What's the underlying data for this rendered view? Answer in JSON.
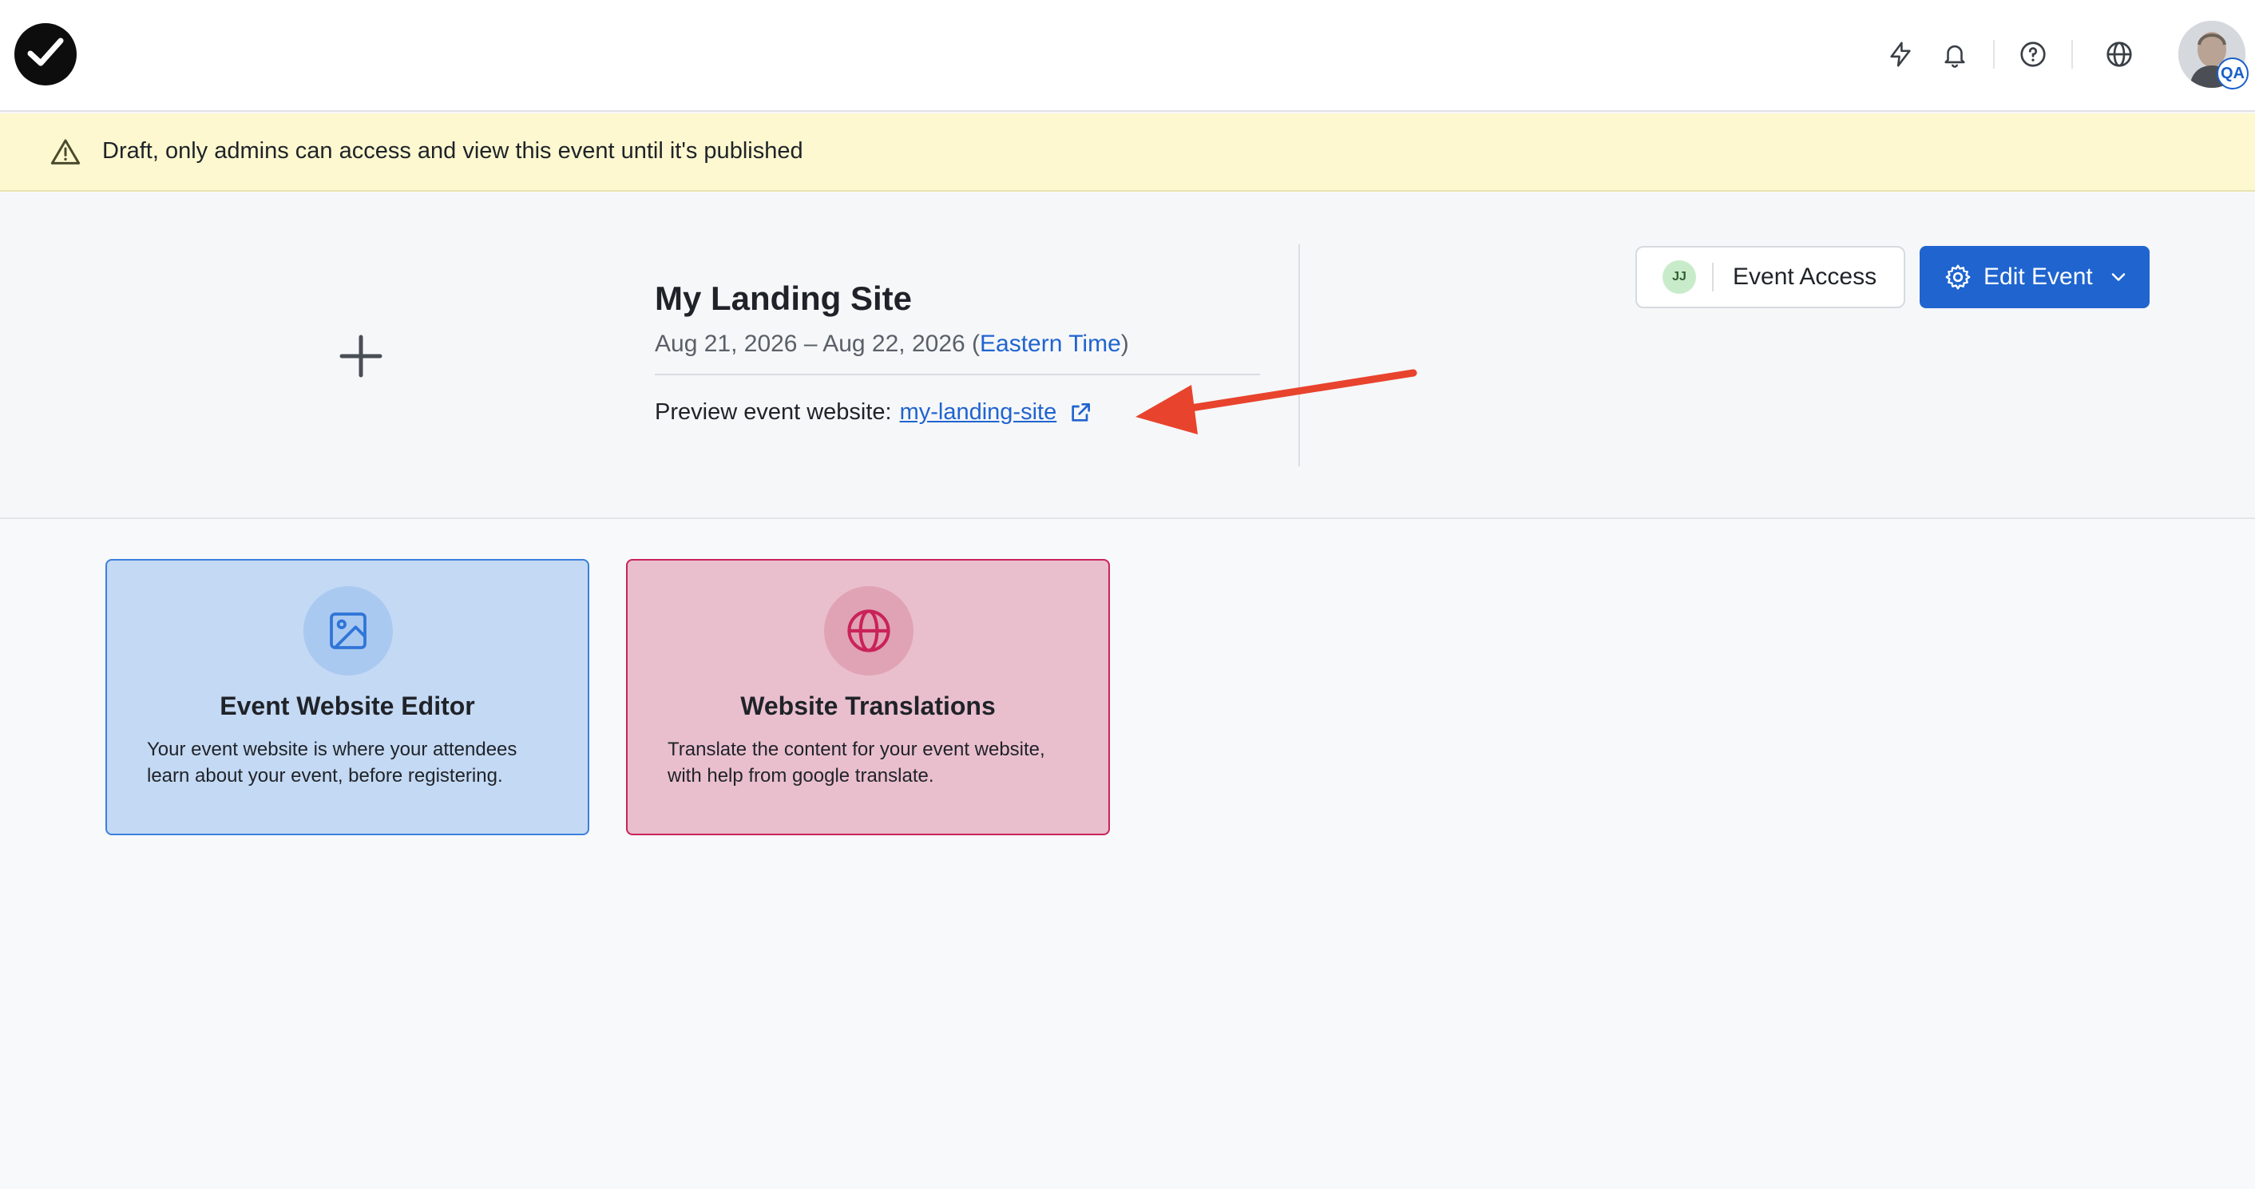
{
  "topbar": {
    "logo": "checkmark-logo",
    "icons": [
      "lightning-icon",
      "bell-icon",
      "help-icon",
      "globe-icon"
    ],
    "avatar_badge": "QA"
  },
  "banner": {
    "text": "Draft, only admins can access and view this event until it's published"
  },
  "event": {
    "title": "My Landing Site",
    "dates_prefix": "Aug 21, 2026 – Aug 22, 2026 (",
    "timezone": "Eastern Time",
    "dates_suffix": ")",
    "preview_label": "Preview event website:",
    "preview_link": "my-landing-site"
  },
  "actions": {
    "access_initials": "JJ",
    "access_label": "Event Access",
    "edit_label": "Edit Event"
  },
  "cards": [
    {
      "title": "Event Website Editor",
      "description": "Your event website is where your attendees learn about your event, before registering.",
      "icon": "image-icon",
      "color": "#3c80de"
    },
    {
      "title": "Website Translations",
      "description": "Translate the content for your event website, with help from google translate.",
      "icon": "globe-icon",
      "color": "#c9235a"
    }
  ],
  "colors": {
    "primary": "#1f64cf",
    "banner_bg": "#fdf8cf",
    "annotation_arrow": "#e8432d"
  }
}
